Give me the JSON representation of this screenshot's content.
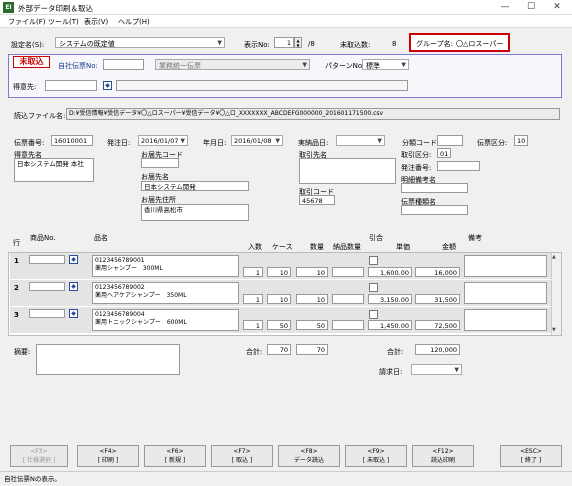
{
  "window": {
    "title": "外部データ印刷＆取込",
    "minimize": "—",
    "maximize": "☐",
    "close": "✕"
  },
  "menu": [
    "ファイル(F)",
    "ツール(T)",
    "表示(V)",
    "ヘルプ(H)"
  ],
  "top": {
    "setting_label": "設定名(S):",
    "setting_value": "システムの既定値",
    "display_no_label": "表示No:",
    "display_no": "1",
    "display_total": "/8",
    "imported_label": "未取込数:",
    "imported_value": "8",
    "group_label": "グループ名:",
    "group_value": "〇△ロスーパー"
  },
  "panel": {
    "status": "未取込",
    "own_slip_label": "自社伝票No:",
    "slip_type": "業務統一伝票",
    "pattern_label": "パターンNo:",
    "pattern_value": "標準",
    "customer_label": "得意先:"
  },
  "file": {
    "label": "読込ファイル名:",
    "value": "D:¥受信情報¥受信データ¥〇△ロスーパー¥受信データ¥〇△ロ_XXXXXXX_ABCDEFG000000_201601171500.csv"
  },
  "header": {
    "slip_no_label": "伝票番号:",
    "slip_no": "16010001",
    "order_date_label": "発注日:",
    "order_date": "2016/01/07",
    "deliv_date_label": "年月日:",
    "deliv_date": "2016/01/08",
    "actual_label": "実納品日:",
    "class_code_label": "分類コード:",
    "slip_kind_label": "伝票区分:",
    "slip_kind": "10",
    "customer_name_label": "得意先名",
    "customer_name": "日本システム開発 本社",
    "dest_code_label": "お届先コード",
    "dest_name_label": "お届先名",
    "dest_name": "日本システム開発",
    "dest_addr_label": "お届先住所",
    "dest_addr": "香川県高松市",
    "partner_name_label": "取引先名",
    "partner_code_label": "取引コード",
    "partner_code": "45678",
    "trade_kind_label": "取引区分:",
    "trade_kind": "01",
    "order_no_label": "発注番号:",
    "note_label": "明細備考名",
    "slip_type_name_label": "伝票種類名"
  },
  "grid": {
    "headers": {
      "row": "行",
      "item_no": "商品No.",
      "name": "品名",
      "irisu": "入数",
      "case": "ケース",
      "qty": "数量",
      "deliv_qty": "納品数量",
      "discount": "引合",
      "unit": "単価",
      "amount": "金額",
      "remarks": "備考"
    },
    "rows": [
      {
        "no": "1",
        "code": "0123456789001",
        "name": "薬用シャンプー　300ML",
        "irisu": "1",
        "case": "10",
        "qty": "10",
        "unit": "1,600.00",
        "amount": "16,000"
      },
      {
        "no": "2",
        "code": "0123456789002",
        "name": "薬用ヘアケアシャンプー　350ML",
        "irisu": "1",
        "case": "10",
        "qty": "10",
        "unit": "3,150.00",
        "amount": "31,500"
      },
      {
        "no": "3",
        "code": "0123456789004",
        "name": "薬用トニックシャンプー　600ML",
        "irisu": "1",
        "case": "50",
        "qty": "50",
        "unit": "1,450.00",
        "amount": "72,500"
      }
    ]
  },
  "footer": {
    "summary_label": "摘要:",
    "total_label": "合計:",
    "total_case": "70",
    "total_qty": "70",
    "grand_label": "合計:",
    "grand_total": "120,000",
    "billing_label": "請求日:"
  },
  "fkeys": [
    {
      "key": "<F3>",
      "label": "[ 仕様選択 ]",
      "disabled": true
    },
    {
      "key": "<F4>",
      "label": "[ 印刷 ]"
    },
    {
      "key": "<F6>",
      "label": "[ 新規 ]"
    },
    {
      "key": "<F7>",
      "label": "[ 取込 ]"
    },
    {
      "key": "<F8>",
      "label": "データ読込"
    },
    {
      "key": "<F9>",
      "label": "[ 未取込 ]"
    },
    {
      "key": "<F12>",
      "label": "読込印刷"
    },
    {
      "key": "<ESC>",
      "label": "[ 終了 ]"
    }
  ],
  "status_text": "自社伝票Nの表示。",
  "colors": {
    "red": "#cc0000",
    "panel_border": "#7c7ccc",
    "blue_text": "#1a3a8a"
  }
}
